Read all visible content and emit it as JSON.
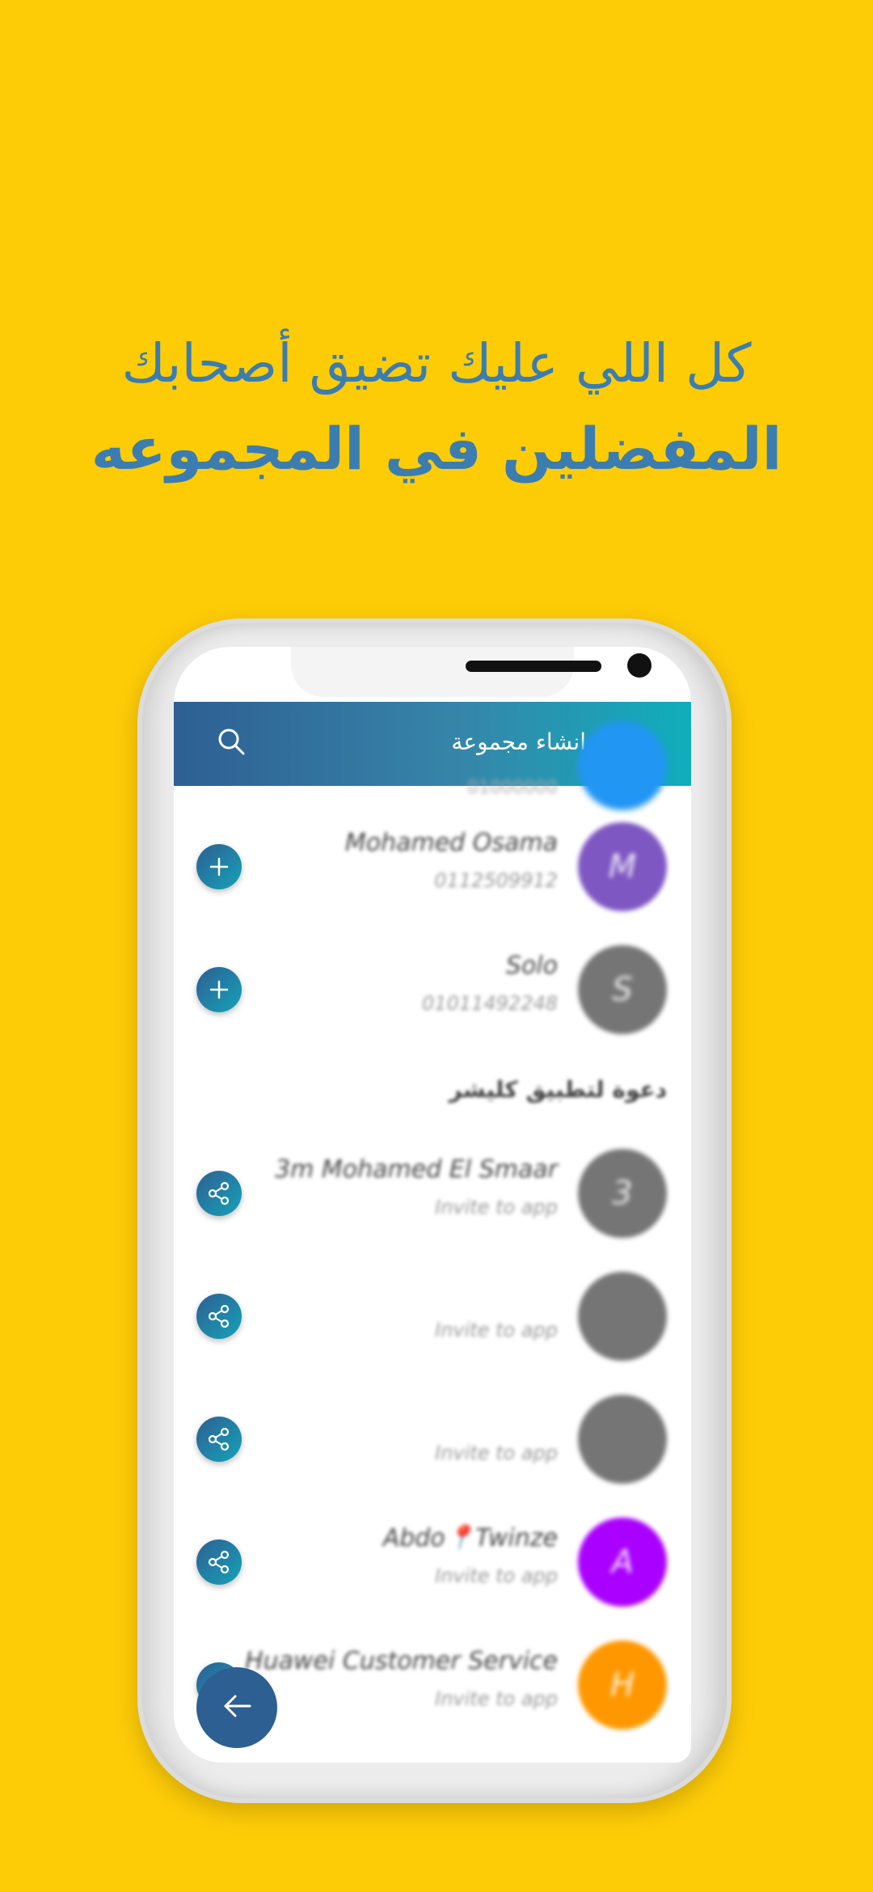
{
  "colors": {
    "background": "#FECC07",
    "headline": "#3B7DB1",
    "appbar_start": "#2E5F93",
    "appbar_end": "#10AEBC"
  },
  "headline": {
    "line1": "كل اللي عليك تضيق أصحابك",
    "line2": "المفضلين في المجموعه"
  },
  "appbar": {
    "title": "انشاء مجموعة",
    "search_icon": "search-icon",
    "back_icon": "arrow-right-icon"
  },
  "partial_row": {
    "sub": "01000000"
  },
  "contacts": [
    {
      "name": "Mohamed Osama",
      "sub": "0112509912",
      "initial": "M",
      "color": "#7E57C2",
      "action": "add"
    },
    {
      "name": "Solo",
      "sub": "01011492248",
      "initial": "S",
      "color": "#757575",
      "action": "add"
    }
  ],
  "section_title": "دعوة لتطبيق كليشر",
  "invites": [
    {
      "name": "3m Mohamed El Smaar",
      "sub": "Invite to app",
      "initial": "3",
      "color": "#757575",
      "action": "share"
    },
    {
      "name": "",
      "sub": "Invite to app",
      "initial": "",
      "color": "#757575",
      "action": "share"
    },
    {
      "name": "",
      "sub": "Invite to app",
      "initial": "",
      "color": "#757575",
      "action": "share"
    },
    {
      "name": "Abdo📍Twinze",
      "sub": "Invite to app",
      "initial": "A",
      "color": "#AA00FF",
      "action": "share"
    },
    {
      "name": "Huawei Customer Service",
      "sub": "Invite to app",
      "initial": "H",
      "color": "#FF9800",
      "action": "share"
    }
  ],
  "fab_icon": "arrow-left-icon"
}
